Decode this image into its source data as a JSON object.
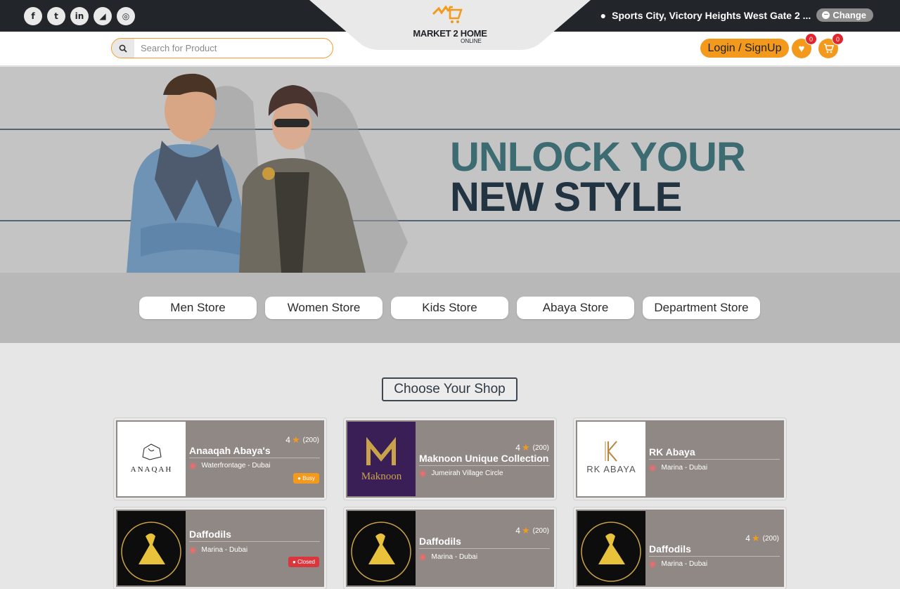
{
  "topbar": {
    "social_icons": [
      {
        "name": "facebook-icon",
        "glyph": "f"
      },
      {
        "name": "twitter-icon",
        "glyph": "t"
      },
      {
        "name": "linkedin-icon",
        "glyph": "in"
      },
      {
        "name": "rss-icon",
        "glyph": "◢"
      },
      {
        "name": "instagram-icon",
        "glyph": "◎"
      }
    ],
    "location_text": "Sports City, Victory Heights West Gate 2 ...",
    "change_label": "Change"
  },
  "logo": {
    "title": "MARKET 2 HOME",
    "subtitle": "ONLINE"
  },
  "header": {
    "search_placeholder": "Search for Product",
    "login_label": "Login / SignUp",
    "wishlist_count": "0",
    "cart_count": "0"
  },
  "banner": {
    "headline_line1": "UNLOCK YOUR",
    "headline_line2": "NEW STYLE"
  },
  "categories": [
    "Men Store",
    "Women Store",
    "Kids Store",
    "Abaya Store",
    "Department Store"
  ],
  "shops_section": {
    "title": "Choose Your Shop"
  },
  "shops": [
    {
      "name": "Anaaqah Abaya's",
      "address": "Waterfrontage - Dubai",
      "rating": "4",
      "reviews": "(200)",
      "status": "Busy",
      "logo_text": "ANAQAH"
    },
    {
      "name": "Maknoon Unique Collection",
      "address": "Jumeirah Village Circle",
      "rating": "4",
      "reviews": "(200)",
      "status": "",
      "logo_text": "Maknoon"
    },
    {
      "name": "RK Abaya",
      "address": "Marina - Dubai",
      "rating": "",
      "reviews": "",
      "status": "",
      "logo_text": "RK ABAYA"
    },
    {
      "name": "Daffodils",
      "address": "Marina - Dubai",
      "rating": "",
      "reviews": "",
      "status": "Closed",
      "logo_text": "Daffodils"
    },
    {
      "name": "Daffodils",
      "address": "Marina - Dubai",
      "rating": "4",
      "reviews": "(200)",
      "status": "",
      "logo_text": "Daffodils"
    },
    {
      "name": "Daffodils",
      "address": "Marina - Dubai",
      "rating": "4",
      "reviews": "(200)",
      "status": "",
      "logo_text": "Daffodils"
    }
  ],
  "colors": {
    "accent": "#f39a1c",
    "topbar": "#22262b",
    "card": "#8f8884",
    "headline_teal": "#3c6b72",
    "headline_navy": "#223342"
  }
}
